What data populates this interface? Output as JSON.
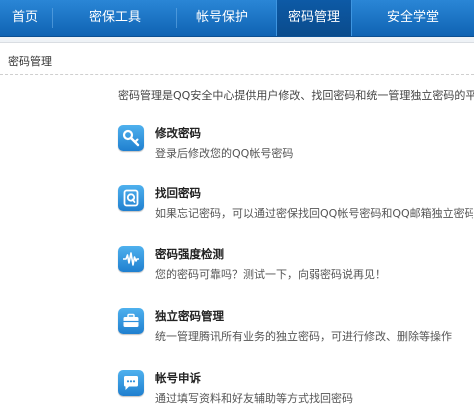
{
  "nav": {
    "items": [
      {
        "label": "首页"
      },
      {
        "label": "密保工具"
      },
      {
        "label": "帐号保护"
      },
      {
        "label": "密码管理"
      },
      {
        "label": "安全学堂"
      }
    ],
    "active": "密码管理"
  },
  "section": {
    "title": "密码管理",
    "intro": "密码管理是QQ安全中心提供用户修改、找回密码和统一管理独立密码的平台"
  },
  "features": [
    {
      "icon": "key-icon",
      "title": "修改密码",
      "desc": "登录后修改您的QQ帐号密码"
    },
    {
      "icon": "find-password-icon",
      "title": "找回密码",
      "desc": "如果忘记密码，可以通过密保找回QQ帐号密码和QQ邮箱独立密码"
    },
    {
      "icon": "waveform-icon",
      "title": "密码强度检测",
      "desc": "您的密码可靠吗？测试一下，向弱密码说再见！"
    },
    {
      "icon": "briefcase-icon",
      "title": "独立密码管理",
      "desc": "统一管理腾讯所有业务的独立密码，可进行修改、删除等操作"
    },
    {
      "icon": "chat-bubble-icon",
      "title": "帐号申诉",
      "desc": "通过填写资料和好友辅助等方式找回密码"
    }
  ],
  "colors": {
    "nav_bg": "#1a73c4",
    "nav_active": "#0b4f92",
    "icon_bg": "#2d8fdb"
  }
}
